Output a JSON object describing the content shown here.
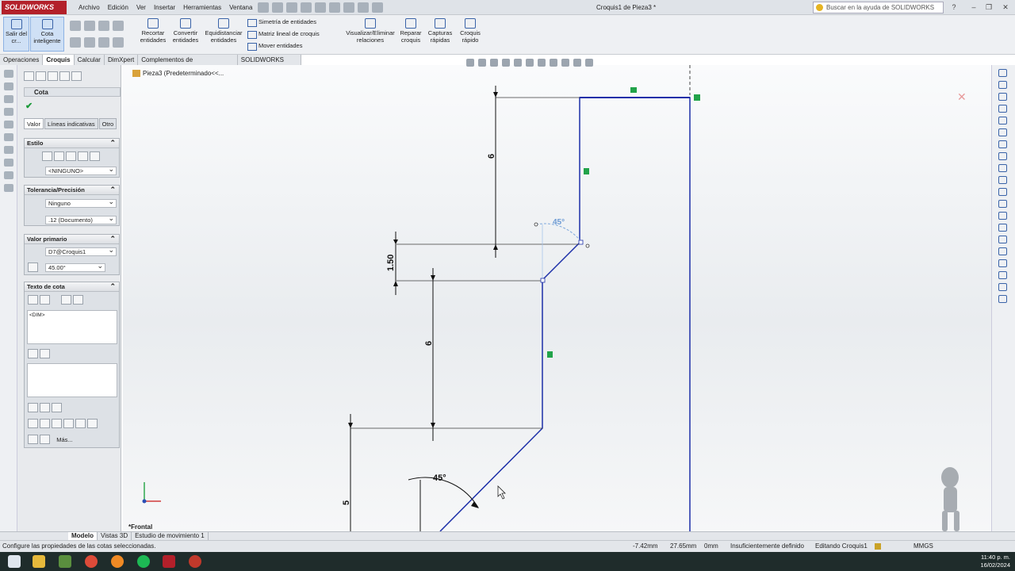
{
  "app": {
    "logo": "SOLIDWORKS",
    "doc_title": "Croquis1 de Pieza3 *",
    "help_placeholder": "Buscar en la ayuda de SOLIDWORKS"
  },
  "menus": [
    "Archivo",
    "Edición",
    "Ver",
    "Insertar",
    "Herramientas",
    "Ventana"
  ],
  "ribbon": {
    "salir": "Salir del cr...",
    "cota": "Cota inteligente",
    "recortar": "Recortar entidades",
    "convertir": "Convertir entidades",
    "equidistanciar": "Equidistanciar entidades",
    "simetria": "Simetría de entidades",
    "matriz": "Matriz lineal de croquis",
    "mover": "Mover entidades",
    "visualizar": "Visualizar/Eliminar relaciones",
    "reparar": "Reparar croquis",
    "capturas": "Capturas rápidas",
    "croquis_rapido": "Croquis rápido"
  },
  "command_tabs": [
    "Operaciones",
    "Croquis",
    "Calcular",
    "DimXpert",
    "Complementos de SOLIDWORKS",
    "SOLIDWORKS MBD"
  ],
  "active_tab": "Croquis",
  "property_manager": {
    "title": "Cota",
    "tabs": [
      "Valor",
      "Líneas indicativas",
      "Otro"
    ],
    "estilo": {
      "title": "Estilo",
      "value": "<NINGUNO>"
    },
    "tolerancia": {
      "title": "Tolerancia/Precisión",
      "tolerance": "Ninguno",
      "precision": ".12 (Documento)"
    },
    "valor_primario": {
      "title": "Valor primario",
      "name": "D7@Croquis1",
      "value": "45.00°"
    },
    "texto_cota": {
      "title": "Texto de cota",
      "dim_text": "<DIM>",
      "mas": "Más..."
    }
  },
  "feature_tree": {
    "root": "Pieza3 (Predeterminado<<..."
  },
  "view_label": "*Frontal",
  "dimensions": {
    "d_top": "6",
    "d_offset": "1.50",
    "d_mid": "6",
    "d_bottom": "5",
    "angle_top": "45°",
    "angle_bottom": "45°"
  },
  "bottom_tabs": [
    "Modelo",
    "Vistas 3D",
    "Estudio de movimiento 1"
  ],
  "status": {
    "message": "Configure las propiedades de las cotas seleccionadas.",
    "x": "-7.42mm",
    "y": "27.65mm",
    "z": "0mm",
    "state": "Insuficientemente definido",
    "editing": "Editando Croquis1",
    "units": "MMGS"
  },
  "clock": {
    "time": "11:40 p. m.",
    "date": "16/02/2024"
  },
  "colors": {
    "accent": "#b3202a",
    "sketch_line": "#1c2fa8",
    "relation": "#22a34a"
  }
}
